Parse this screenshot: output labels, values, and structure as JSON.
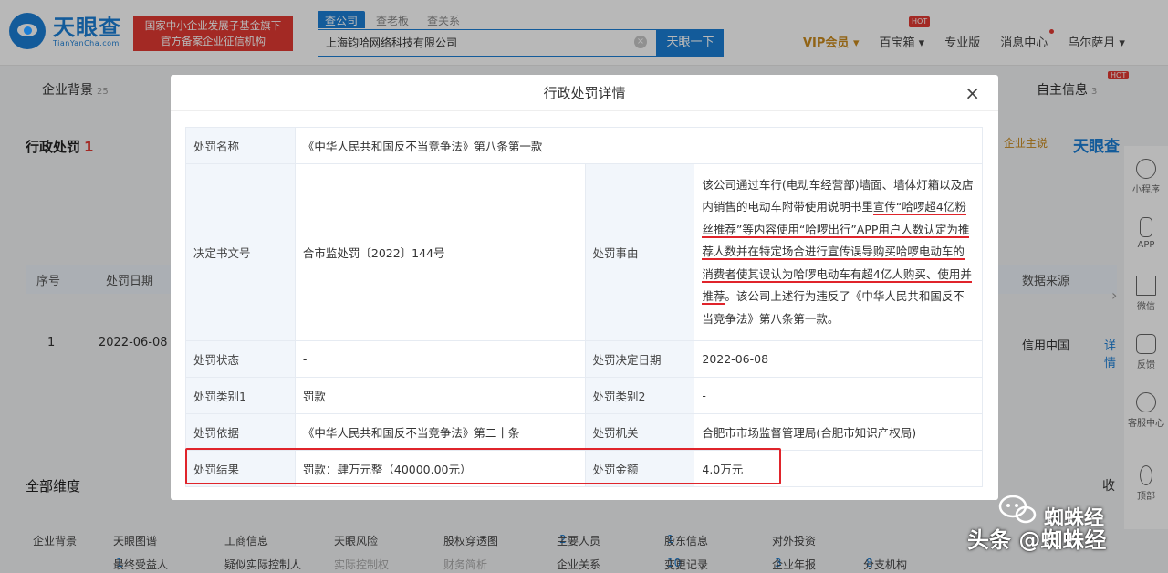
{
  "header": {
    "logo_cn": "天眼查",
    "logo_en": "TianYanCha.com",
    "slogan_line1": "国家中小企业发展子基金旗下",
    "slogan_line2": "官方备案企业征信机构",
    "search_tabs": [
      "查公司",
      "查老板",
      "查关系"
    ],
    "search_value": "上海钧哈网络科技有限公司",
    "search_button": "天眼一下",
    "nav": {
      "vip": "VIP会员",
      "treasure": "百宝箱",
      "hot_badge": "HOT",
      "pro": "专业版",
      "messages": "消息中心",
      "user": "乌尔萨月"
    }
  },
  "background": {
    "tab_left": "企业背景",
    "tab_left_count": "25",
    "tab_right": "自主信息",
    "tab_right_count": "3",
    "tab_right_hot": "HOT",
    "section_title": "行政处罚",
    "section_count": "1",
    "right_link": "企业主说",
    "right_logo": "天眼查",
    "table_headers": [
      "序号",
      "处罚日期",
      "数据来源"
    ],
    "row": {
      "index": "1",
      "date": "2022-06-08",
      "source": "信用中国",
      "detail": "详情"
    },
    "all_dims": "全部维度",
    "dims_right": "收",
    "dim_row1": [
      {
        "label": "企业背景",
        "count": ""
      },
      {
        "label": "天眼图谱",
        "count": ""
      },
      {
        "label": "工商信息",
        "count": ""
      },
      {
        "label": "天眼风险",
        "count": ""
      },
      {
        "label": "股权穿透图",
        "count": ""
      },
      {
        "label": "主要人员",
        "count": "2"
      },
      {
        "label": "股东信息",
        "count": "1"
      },
      {
        "label": "对外投资",
        "count": ""
      }
    ],
    "dim_row2": [
      {
        "label": "最终受益人",
        "count": "1"
      },
      {
        "label": "疑似实际控制人",
        "count": ""
      },
      {
        "label": "实际控制权",
        "count": ""
      },
      {
        "label": "财务简析",
        "count": ""
      },
      {
        "label": "企业关系",
        "count": ""
      },
      {
        "label": "变更记录",
        "count": "10"
      },
      {
        "label": "企业年报",
        "count": "3"
      },
      {
        "label": "分支机构",
        "count": "8"
      }
    ],
    "side_panel": [
      "小程序",
      "APP",
      "微信",
      "反馈",
      "客服中心",
      "顶部"
    ]
  },
  "modal": {
    "title": "行政处罚详情",
    "close": "×",
    "rows": {
      "name_label": "处罚名称",
      "name_value": "《中华人民共和国反不当竞争法》第八条第一款",
      "doc_label": "决定书文号",
      "doc_value": "合市监处罚〔2022〕144号",
      "reason_label": "处罚事由",
      "reason_parts": [
        "该公司通过车行(电动车经营部)墙面、墙体灯箱以及店内销售的电动车附带使用说明书里",
        "宣传“哈啰超4亿粉丝推荐”等内容使用“哈啰出行”APP用户人数认定为推荐人数并在特定场合进行宣传误导购买哈啰电动车的消费者使其误认为哈啰电动车有超4亿人购买、使用并推荐",
        "。该公司上述行为违反了《中华人民共和国反不当竞争法》第八条第一款。"
      ],
      "status_label": "处罚状态",
      "status_value": "-",
      "decision_date_label": "处罚决定日期",
      "decision_date_value": "2022-06-08",
      "type1_label": "处罚类别1",
      "type1_value": "罚款",
      "type2_label": "处罚类别2",
      "type2_value": "-",
      "basis_label": "处罚依据",
      "basis_value": "《中华人民共和国反不当竞争法》第二十条",
      "authority_label": "处罚机关",
      "authority_value": "合肥市市场监督管理局(合肥市知识产权局)",
      "result_label": "处罚结果",
      "result_value": "罚款：肆万元整（40000.00元）",
      "amount_label": "处罚金额",
      "amount_value": "4.0万元"
    }
  },
  "watermark": {
    "line1": "蜘蛛经",
    "line2": "头条 @蜘蛛经"
  }
}
